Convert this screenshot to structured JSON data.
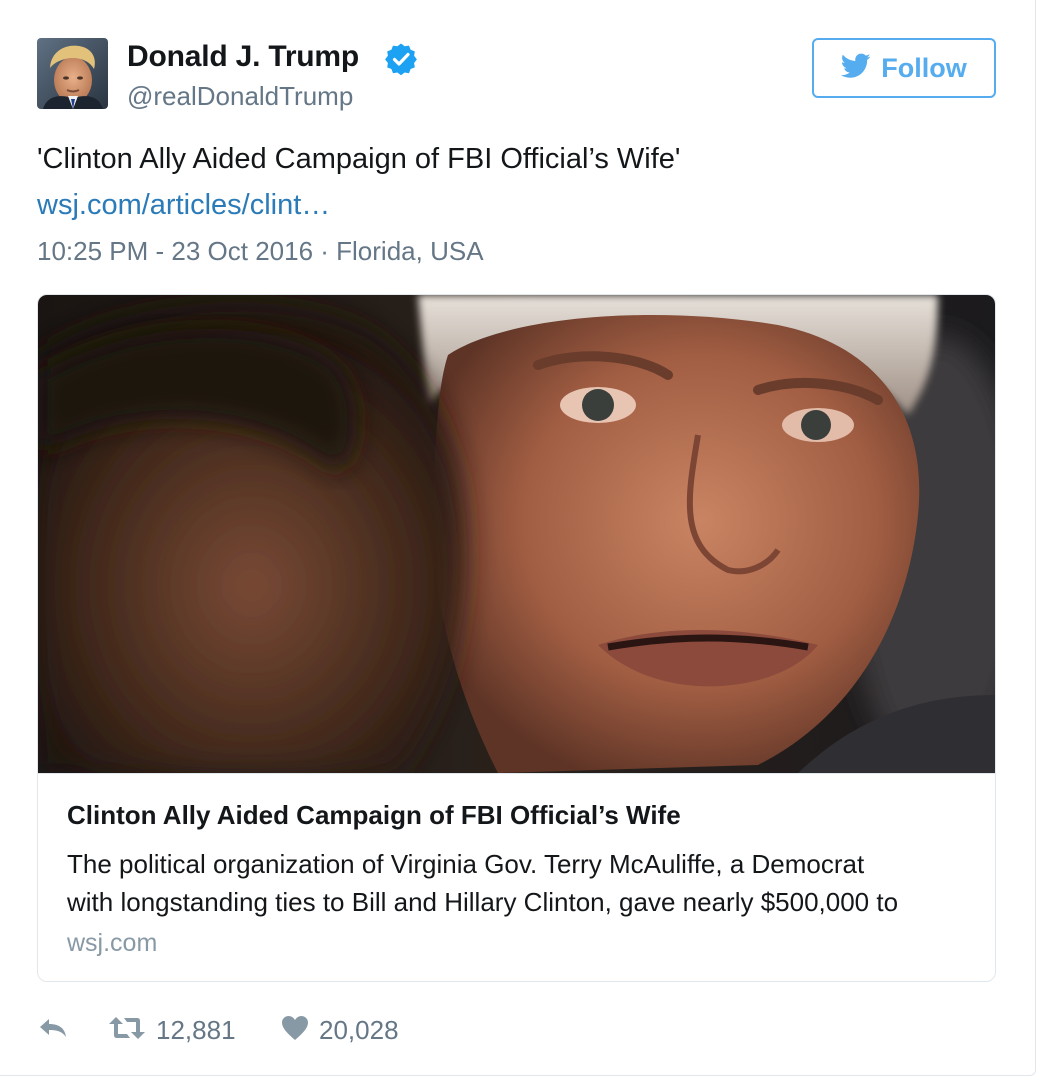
{
  "author": {
    "name": "Donald J. Trump",
    "handle": "@realDonaldTrump",
    "avatar_icon": "user-avatar",
    "verified_icon": "verified-badge-icon"
  },
  "follow_button": {
    "label": "Follow",
    "icon": "twitter-bird-icon",
    "color": "#55acee"
  },
  "tweet": {
    "text": "'Clinton Ally Aided Campaign of FBI Official’s Wife'",
    "link": "wsj.com/articles/clint…",
    "meta": "10:25 PM - 23 Oct 2016 · Florida, USA"
  },
  "card": {
    "image_icon": "article-photo",
    "title": "Clinton Ally Aided Campaign of FBI Official’s Wife",
    "description_lines": [
      "The political organization of Virginia Gov. Terry McAuliffe, a Democrat",
      "with longstanding ties to Bill and Hillary Clinton, gave nearly $500,000 to"
    ],
    "domain": "wsj.com"
  },
  "actions": {
    "reply_icon": "reply-icon",
    "retweet_icon": "retweet-icon",
    "retweet_count": "12,881",
    "like_icon": "heart-icon",
    "like_count": "20,028"
  },
  "colors": {
    "link": "#2b7bb9",
    "muted": "#657786",
    "accent": "#55acee",
    "border": "#e1e8ed"
  }
}
